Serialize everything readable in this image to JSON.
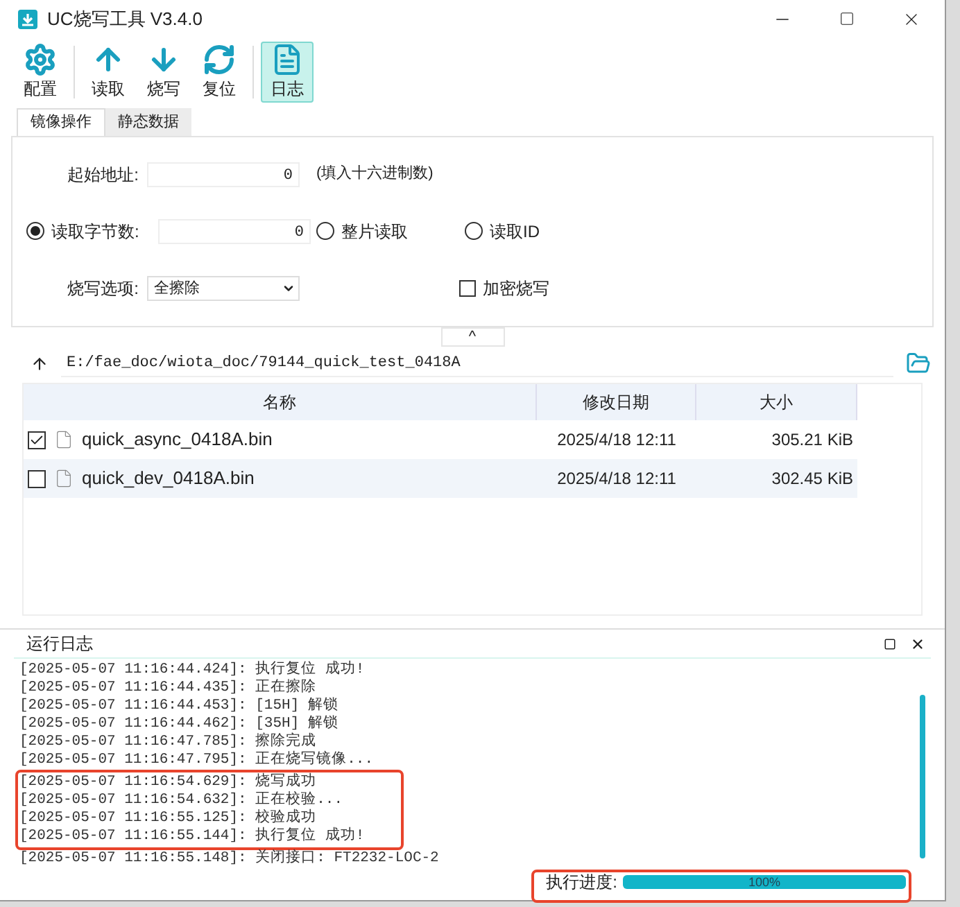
{
  "window": {
    "title": "UC烧写工具 V3.4.0"
  },
  "toolbar": [
    {
      "label": "配置",
      "selected": false
    },
    {
      "label": "读取",
      "selected": false
    },
    {
      "label": "烧写",
      "selected": false
    },
    {
      "label": "复位",
      "selected": false
    },
    {
      "label": "日志",
      "selected": true
    }
  ],
  "tabs": [
    {
      "label": "镜像操作",
      "selected": true
    },
    {
      "label": "静态数据",
      "selected": false
    }
  ],
  "form": {
    "start_address": {
      "label": "起始地址:",
      "value": "0",
      "hint": "(填入十六进制数)"
    },
    "read_modes": [
      {
        "label": "读取字节数:",
        "selected": true,
        "value": "0"
      },
      {
        "label": "整片读取",
        "selected": false
      },
      {
        "label": "读取ID",
        "selected": false
      }
    ],
    "burn_option": {
      "label": "烧写选项:",
      "value": "全擦除"
    },
    "encrypt": {
      "label": "加密烧写",
      "checked": false
    }
  },
  "collapse_button": "^",
  "path": {
    "value": "E:/fae_doc/wiota_doc/79144_quick_test_0418A"
  },
  "table": {
    "columns": [
      "名称",
      "修改日期",
      "大小"
    ],
    "rows": [
      {
        "checked": true,
        "name": "quick_async_0418A.bin",
        "date": "2025/4/18 12:11",
        "size": "305.21 KiB"
      },
      {
        "checked": false,
        "name": "quick_dev_0418A.bin",
        "date": "2025/4/18 12:11",
        "size": "302.45 KiB"
      }
    ]
  },
  "log": {
    "title": "运行日志",
    "lines": [
      "[2025-05-07 11:16:44.424]: 执行复位 成功!",
      "[2025-05-07 11:16:44.435]: 正在擦除",
      "[2025-05-07 11:16:44.453]: [15H] 解锁",
      "[2025-05-07 11:16:44.462]: [35H] 解锁",
      "[2025-05-07 11:16:47.785]: 擦除完成",
      "[2025-05-07 11:16:47.795]: 正在烧写镜像...",
      "[2025-05-07 11:16:54.629]: 烧写成功",
      "[2025-05-07 11:16:54.632]: 正在校验...",
      "[2025-05-07 11:16:55.125]: 校验成功",
      "[2025-05-07 11:16:55.144]: 执行复位 成功!",
      "[2025-05-07 11:16:55.148]: 关闭接口: FT2232-LOC-2"
    ],
    "progress": {
      "label": "执行进度:",
      "level": 1,
      "reading": "100%"
    }
  }
}
